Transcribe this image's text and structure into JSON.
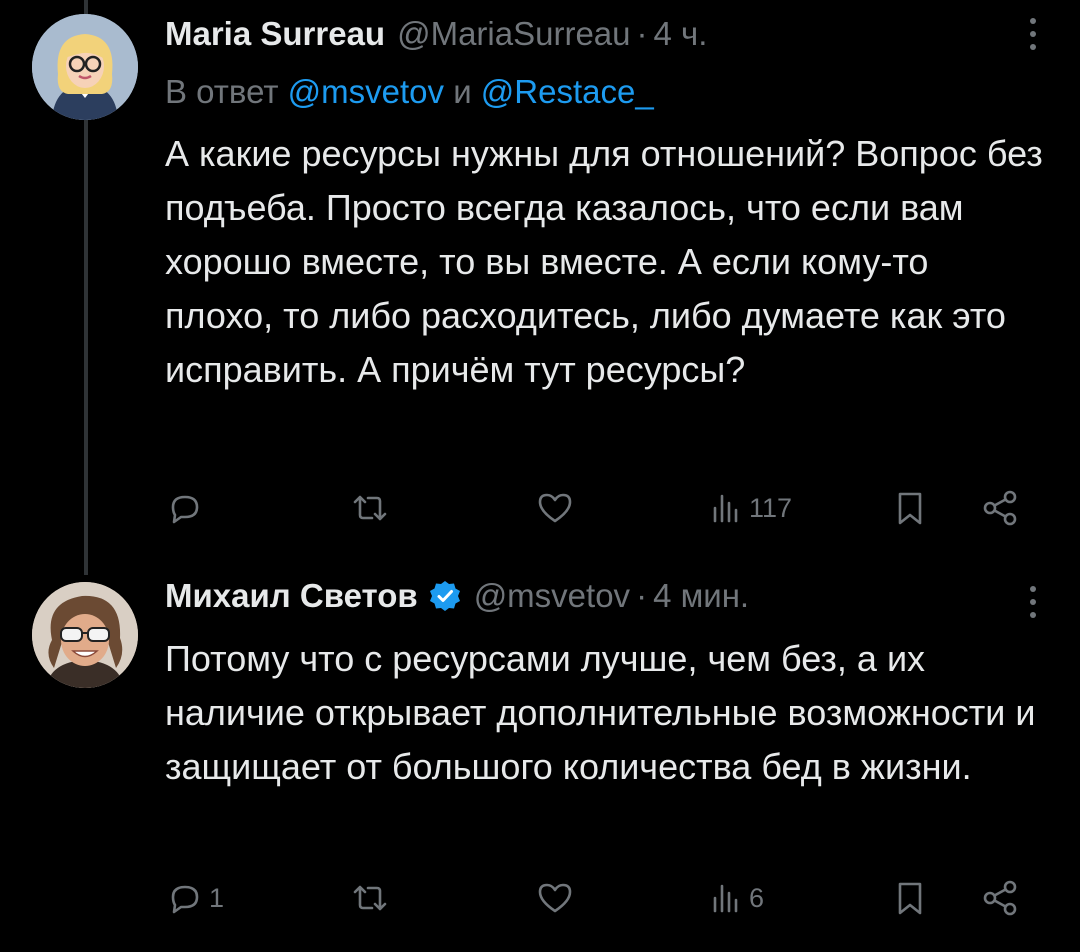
{
  "tweets": [
    {
      "author_name": "Maria Surreau",
      "handle": "@MariaSurreau",
      "separator": "·",
      "time": "4 ч.",
      "reply_to_prefix": "В ответ",
      "reply_to_first": "@msvetov",
      "reply_to_joiner": "и",
      "reply_to_second": "@Restace_",
      "text": "А какие ресурсы нужны для отношений? Вопрос без подъеба. Просто всегда казалось, что если вам хорошо вместе, то вы вместе. А если кому-то плохо, то либо расходитесь, либо думаете как это исправить. А причём тут ресурсы?",
      "actions": {
        "replies": "",
        "retweets": "",
        "likes": "",
        "views": "117"
      },
      "verified": false
    },
    {
      "author_name": "Михаил Светов",
      "handle": "@msvetov",
      "separator": "·",
      "time": "4 мин.",
      "text": "Потому что с ресурсами лучше, чем без, а их наличие открывает дополнительные возможности и защищает от большого количества бед в жизни.",
      "actions": {
        "replies": "1",
        "retweets": "",
        "likes": "",
        "views": "6"
      },
      "verified": true
    }
  ],
  "icons": [
    "reply-icon",
    "retweet-icon",
    "like-icon",
    "views-icon",
    "bookmark-icon",
    "share-icon",
    "more-icon",
    "verified-badge-icon"
  ],
  "colors": {
    "background": "#000000",
    "text": "#e7e9ea",
    "secondary": "#71767b",
    "accent": "#1d9bf0"
  }
}
